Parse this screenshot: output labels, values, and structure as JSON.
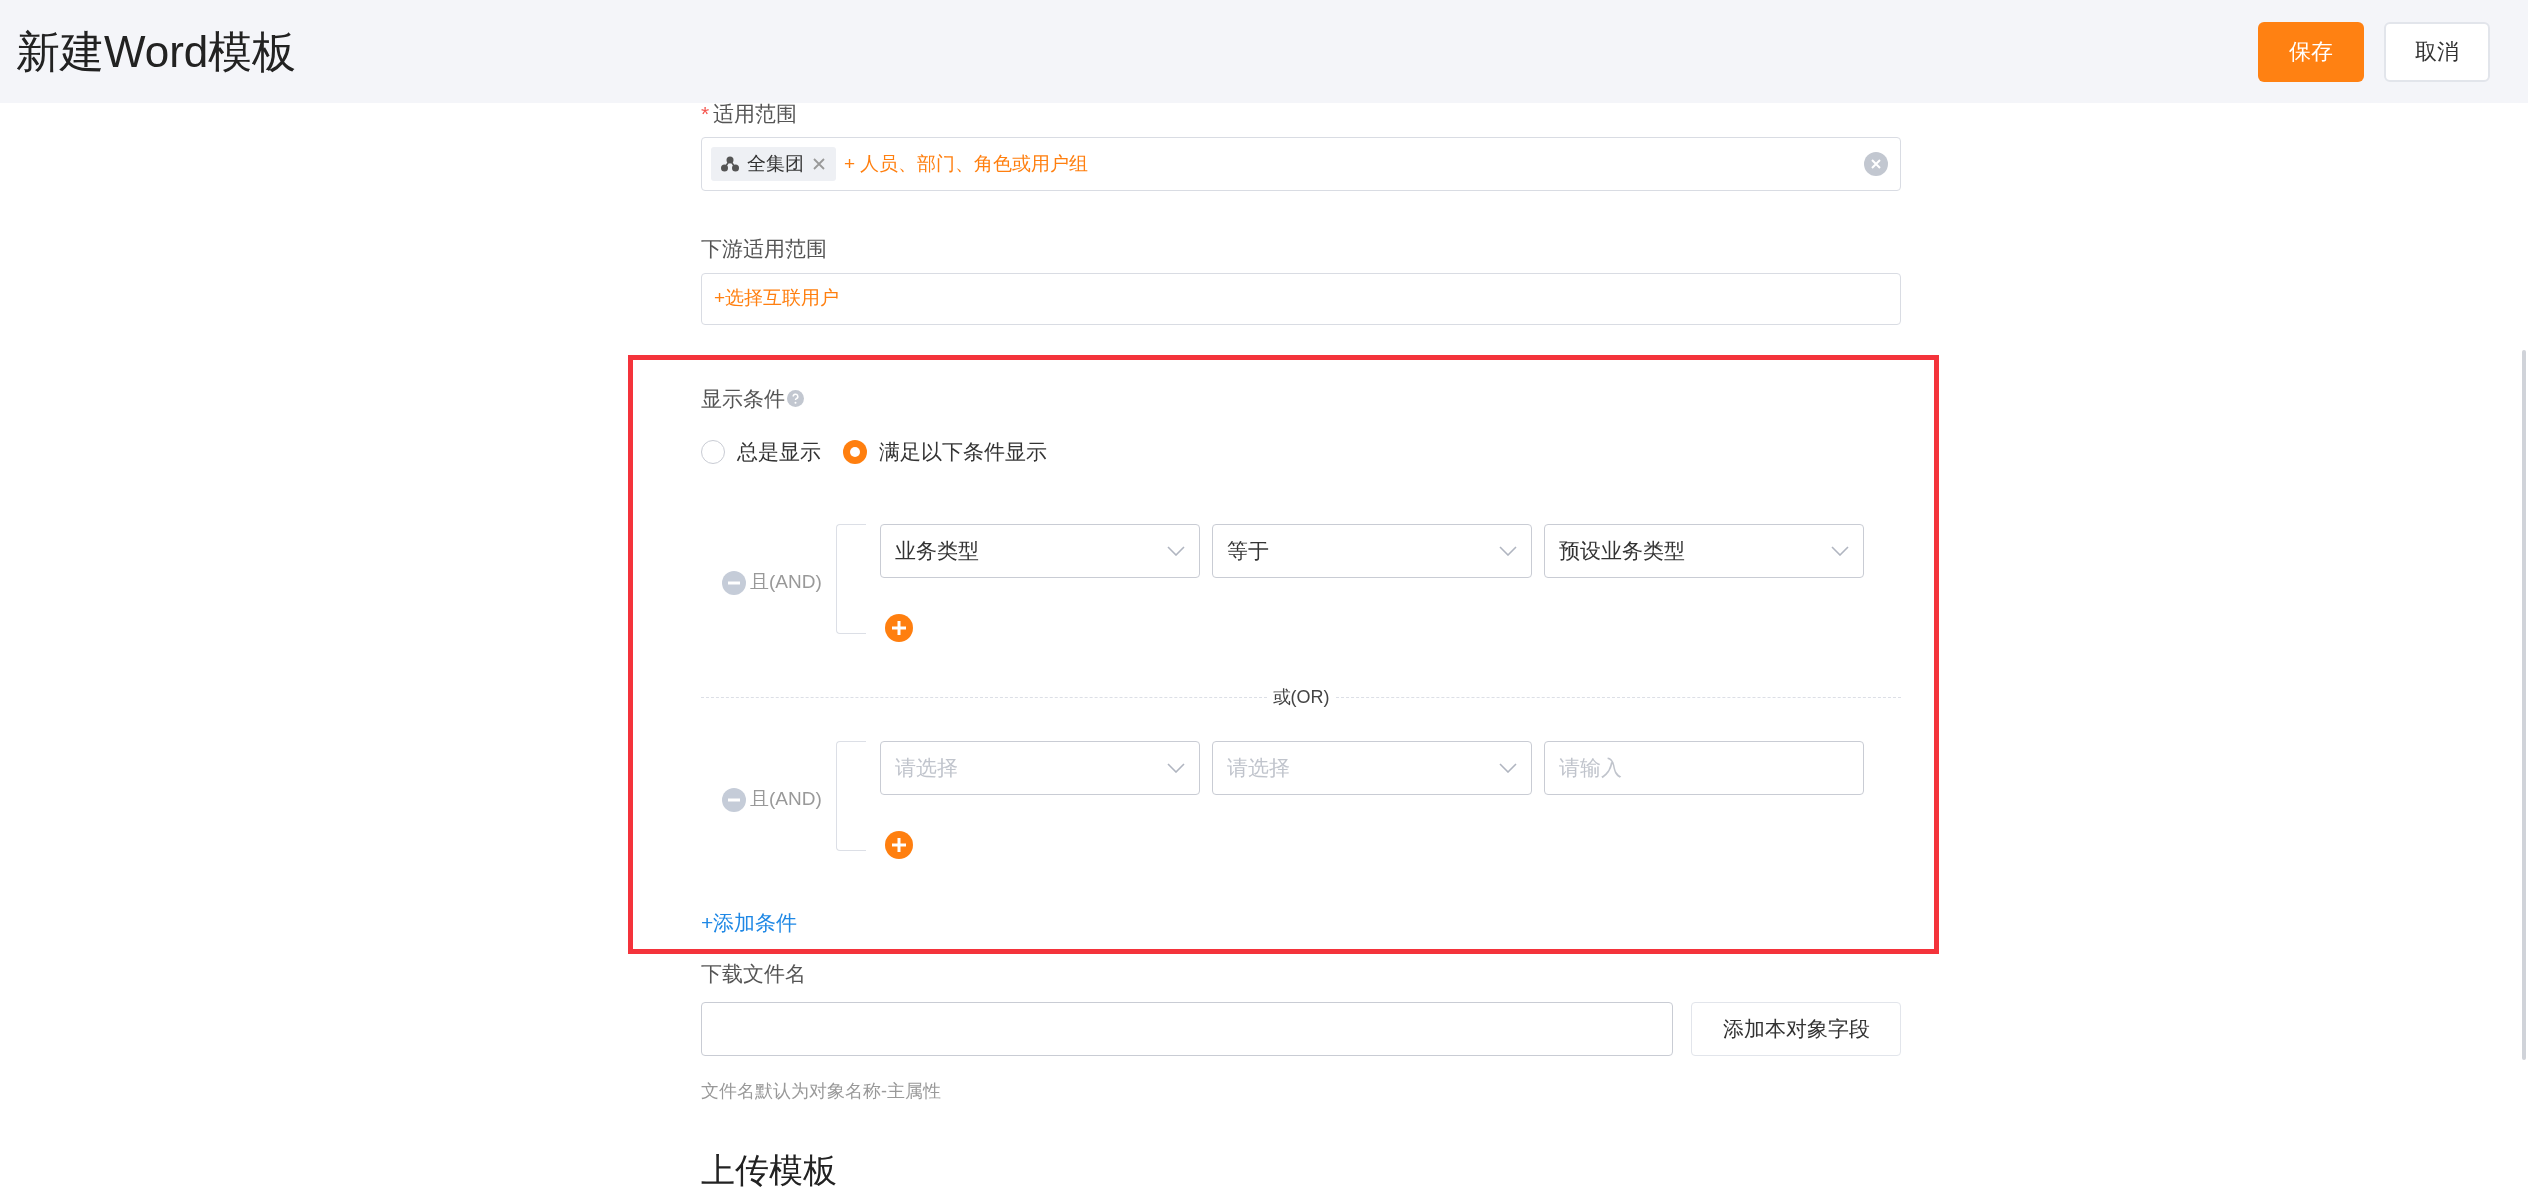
{
  "header": {
    "title": "新建Word模板",
    "buttons": [
      {
        "label": "保存",
        "kind": "primary"
      },
      {
        "label": "取消",
        "kind": "default"
      }
    ]
  },
  "scope": {
    "label": "适用范围",
    "required_mark": "*",
    "tags": [
      {
        "label": "全集团"
      }
    ],
    "add_link": "+ 人员、部门、角色或用户组"
  },
  "downstream": {
    "label": "下游适用范围",
    "add_link": "+选择互联用户"
  },
  "display_conditions": {
    "label": "显示条件",
    "options": [
      {
        "label": "总是显示",
        "selected": false
      },
      {
        "label": "满足以下条件显示",
        "selected": true
      }
    ],
    "groups": [
      {
        "connector": "且(AND)",
        "fields": [
          {
            "kind": "select",
            "value": "业务类型"
          },
          {
            "kind": "select",
            "value": "等于"
          },
          {
            "kind": "select",
            "value": "预设业务类型"
          }
        ]
      },
      {
        "connector": "且(AND)",
        "fields": [
          {
            "kind": "select",
            "placeholder": "请选择"
          },
          {
            "kind": "select",
            "placeholder": "请选择"
          },
          {
            "kind": "input",
            "placeholder": "请输入"
          }
        ]
      }
    ],
    "separator": "或(OR)",
    "add_condition": "+添加条件"
  },
  "filename": {
    "label": "下载文件名",
    "button": "添加本对象字段",
    "hint": "文件名默认为对象名称-主属性"
  },
  "upload": {
    "title": "上传模板"
  }
}
